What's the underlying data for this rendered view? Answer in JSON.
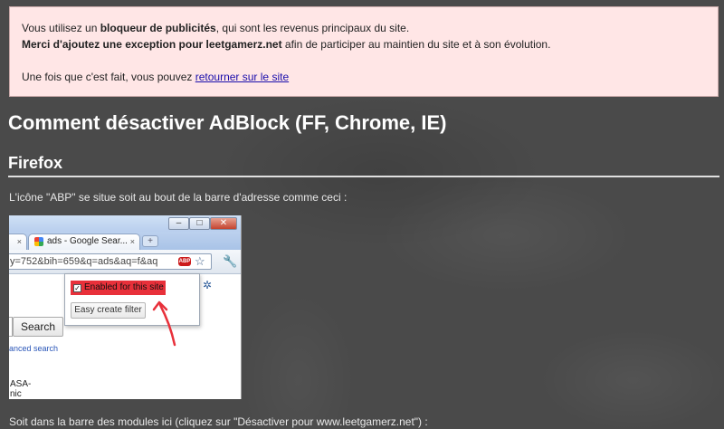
{
  "notice": {
    "line1_pre": "Vous utilisez un ",
    "line1_bold": "bloqueur de publicités",
    "line1_post": ", qui sont les revenus principaux du site.",
    "line2_bold": "Merci d'ajoutez une exception pour leetgamerz.net",
    "line2_post": " afin de participer au maintien du site et à son évolution.",
    "line3_pre": "Une fois que c'est fait, vous pouvez ",
    "line3_link": "retourner sur le site"
  },
  "main_title": "Comment désactiver AdBlock (FF, Chrome, IE)",
  "section_title": "Firefox",
  "para1": "L'icône \"ABP\" se situe soit au bout de la barre d'adresse comme ceci :",
  "para2": "Soit dans la barre des modules ici (cliquez sur \"Désactiver pour www.leetgamerz.net\") :",
  "screenshot": {
    "window_buttons": {
      "minimize": "–",
      "maximize": "□",
      "close": "✕"
    },
    "tab_left_close": "×",
    "tab_title": "ads - Google Sear...",
    "tab_close": "×",
    "new_tab": "+",
    "url": "y=752&bih=659&q=ads&aq=f&aq",
    "abp_badge": "ABP",
    "star_icon": "star-icon",
    "wrench_icon": "wrench-icon",
    "gear_icon": "gear-icon",
    "popup": {
      "enabled_label": "Enabled for this site",
      "enabled_checked": true,
      "filter_button": "Easy create filter"
    },
    "search_button": "Search",
    "advanced_search": "anced search",
    "fragment1": "ASA-",
    "fragment2": "nic",
    "arrow_color": "#e8303a"
  }
}
